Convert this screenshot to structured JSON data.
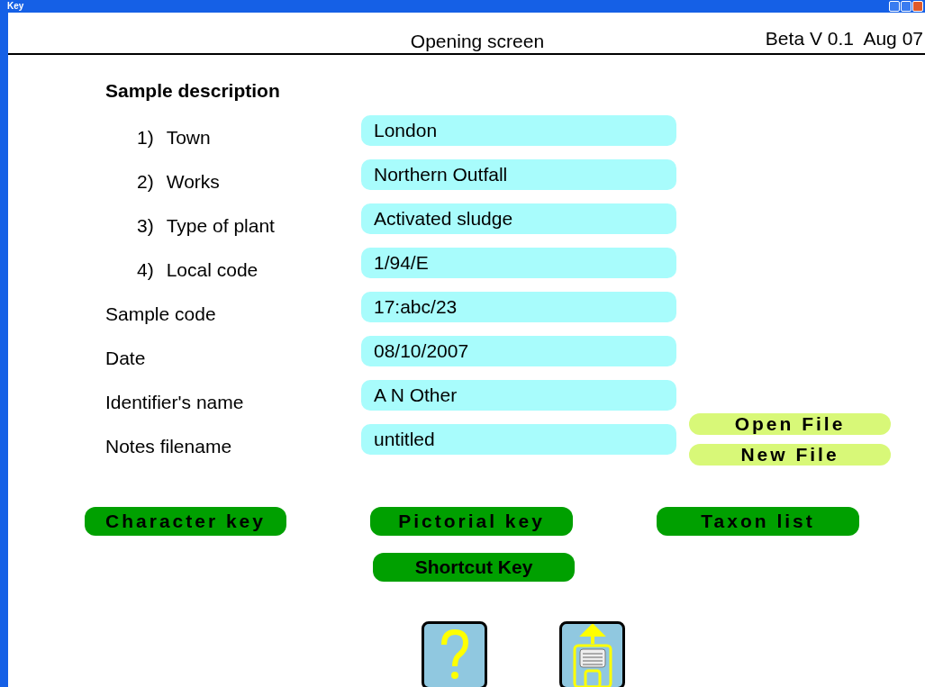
{
  "window": {
    "title": "Key"
  },
  "header": {
    "title": "Opening screen",
    "version": "Beta V 0.1  Aug 07"
  },
  "section_title": "Sample description",
  "fields": [
    {
      "number": "1)",
      "label": "Town",
      "value": "London"
    },
    {
      "number": "2)",
      "label": "Works",
      "value": "Northern Outfall"
    },
    {
      "number": "3)",
      "label": "Type of plant",
      "value": "Activated sludge"
    },
    {
      "number": "4)",
      "label": "Local code",
      "value": "1/94/E"
    },
    {
      "label": "Sample code",
      "value": "17:abc/23"
    },
    {
      "label": "Date",
      "value": "08/10/2007"
    },
    {
      "label": "Identifier's name",
      "value": "A N Other"
    },
    {
      "label": "Notes filename",
      "value": "untitled"
    }
  ],
  "file_buttons": [
    "Open File",
    "New File"
  ],
  "key_buttons": [
    "Character key",
    "Pictorial key",
    "Taxon list"
  ],
  "shortcut_button": "Shortcut Key"
}
